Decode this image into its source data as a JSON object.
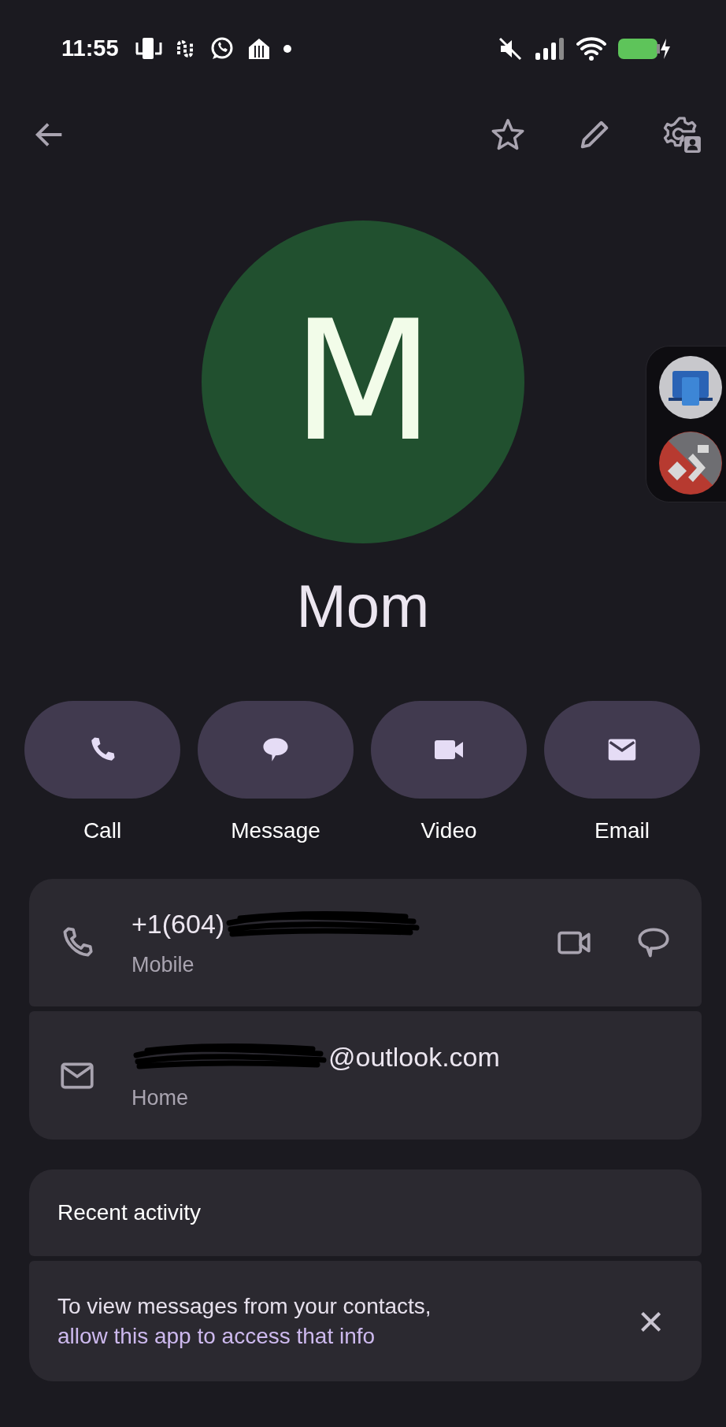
{
  "status_bar": {
    "time": "11:55"
  },
  "contact": {
    "initial": "M",
    "name": "Mom",
    "starred": false
  },
  "actions": [
    {
      "label": "Call",
      "kind": "call"
    },
    {
      "label": "Message",
      "kind": "message"
    },
    {
      "label": "Video",
      "kind": "video"
    },
    {
      "label": "Email",
      "kind": "email"
    }
  ],
  "details": [
    {
      "kind": "phone",
      "value": "+1(604)",
      "redacted": true,
      "label": "Mobile"
    },
    {
      "kind": "email",
      "value": "@outlook.com",
      "redacted": true,
      "label": "Home"
    }
  ],
  "recent_activity": {
    "title": "Recent activity",
    "notice": "To view messages from your contacts,",
    "link": "allow this app to access that info",
    "close": "×"
  }
}
